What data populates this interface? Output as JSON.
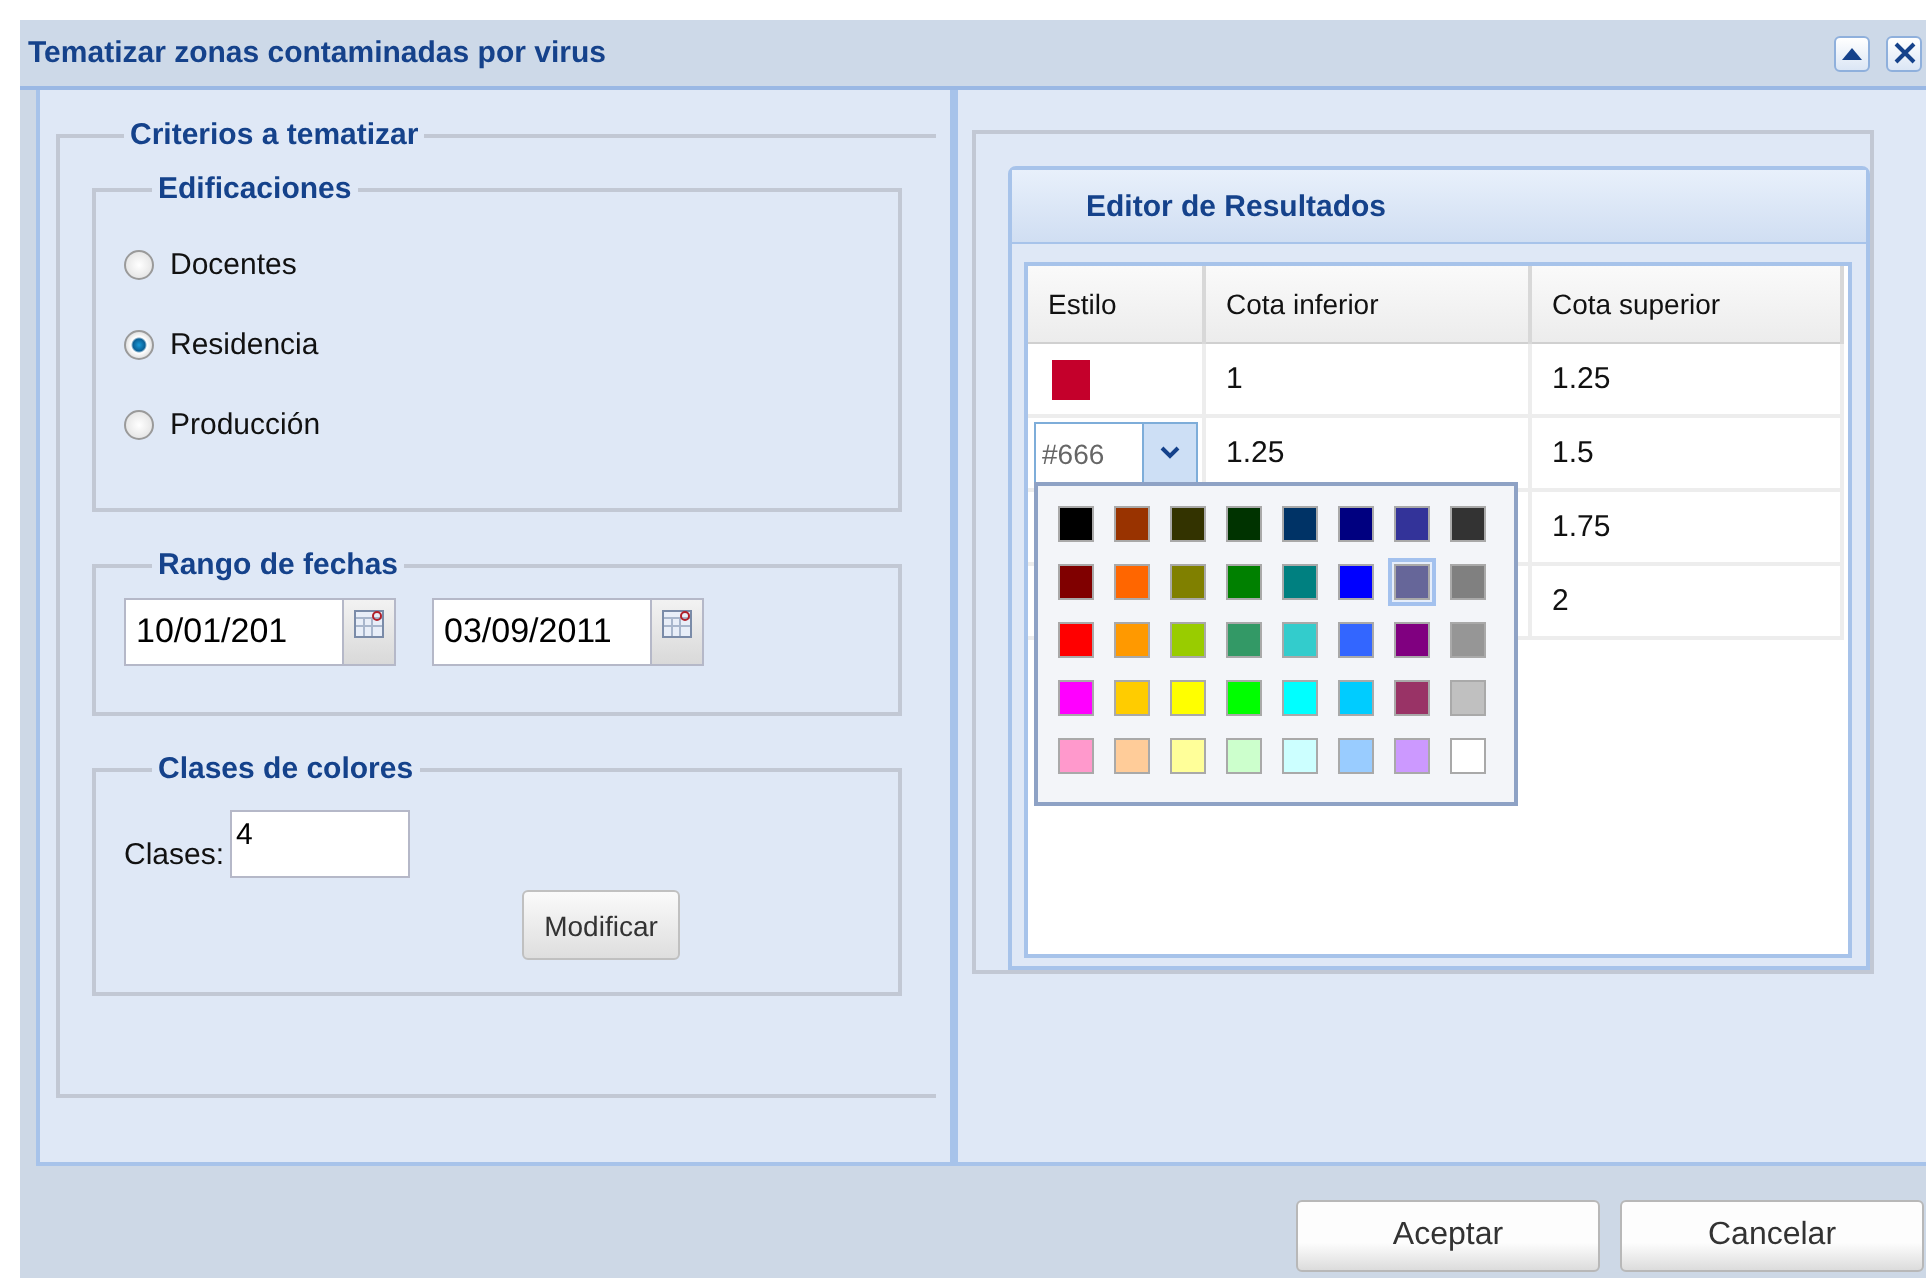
{
  "window": {
    "title": "Tematizar zonas contaminadas por virus"
  },
  "criteria": {
    "title": "Criterios a tematizar",
    "buildings": {
      "title": "Edificaciones",
      "options": [
        {
          "label": "Docentes",
          "selected": false
        },
        {
          "label": "Residencia",
          "selected": true
        },
        {
          "label": "Producción",
          "selected": false
        }
      ]
    },
    "date_range": {
      "title": "Rango de fechas",
      "from": "10/01/201",
      "to": "03/09/2011"
    },
    "color_classes": {
      "title": "Clases de colores",
      "label": "Clases:",
      "value": "4",
      "button": "Modificar"
    }
  },
  "results": {
    "title": "Editor de Resultados",
    "columns": [
      "Estilo",
      "Cota inferior",
      "Cota superior"
    ],
    "rows": [
      {
        "kind": "swatch",
        "color": "#c4002b",
        "cota_inferior": "1",
        "cota_superior": "1.25"
      },
      {
        "kind": "editor",
        "value": "#666",
        "cota_inferior": "1.25",
        "cota_superior": "1.5"
      },
      {
        "cota_superior": "1.75"
      },
      {
        "cota_superior": "2"
      }
    ],
    "palette": [
      {
        "color": "#000000",
        "selected": false
      },
      {
        "color": "#993300",
        "selected": false
      },
      {
        "color": "#333300",
        "selected": false
      },
      {
        "color": "#003300",
        "selected": false
      },
      {
        "color": "#003366",
        "selected": false
      },
      {
        "color": "#000080",
        "selected": false
      },
      {
        "color": "#333399",
        "selected": false
      },
      {
        "color": "#333333",
        "selected": false
      },
      {
        "color": "#800000",
        "selected": false
      },
      {
        "color": "#ff6600",
        "selected": false
      },
      {
        "color": "#808000",
        "selected": false
      },
      {
        "color": "#008000",
        "selected": false
      },
      {
        "color": "#008080",
        "selected": false
      },
      {
        "color": "#0000ff",
        "selected": false
      },
      {
        "color": "#666699",
        "selected": true
      },
      {
        "color": "#808080",
        "selected": false
      },
      {
        "color": "#ff0000",
        "selected": false
      },
      {
        "color": "#ff9900",
        "selected": false
      },
      {
        "color": "#99cc00",
        "selected": false
      },
      {
        "color": "#339966",
        "selected": false
      },
      {
        "color": "#33cccc",
        "selected": false
      },
      {
        "color": "#3366ff",
        "selected": false
      },
      {
        "color": "#800080",
        "selected": false
      },
      {
        "color": "#969696",
        "selected": false
      },
      {
        "color": "#ff00ff",
        "selected": false
      },
      {
        "color": "#ffcc00",
        "selected": false
      },
      {
        "color": "#ffff00",
        "selected": false
      },
      {
        "color": "#00ff00",
        "selected": false
      },
      {
        "color": "#00ffff",
        "selected": false
      },
      {
        "color": "#00ccff",
        "selected": false
      },
      {
        "color": "#993366",
        "selected": false
      },
      {
        "color": "#c0c0c0",
        "selected": false
      },
      {
        "color": "#ff99cc",
        "selected": false
      },
      {
        "color": "#ffcc99",
        "selected": false
      },
      {
        "color": "#ffff99",
        "selected": false
      },
      {
        "color": "#ccffcc",
        "selected": false
      },
      {
        "color": "#ccffff",
        "selected": false
      },
      {
        "color": "#99ccff",
        "selected": false
      },
      {
        "color": "#cc99ff",
        "selected": false
      },
      {
        "color": "#ffffff",
        "selected": false
      }
    ]
  },
  "buttons": [
    "Aceptar",
    "Cancelar"
  ]
}
